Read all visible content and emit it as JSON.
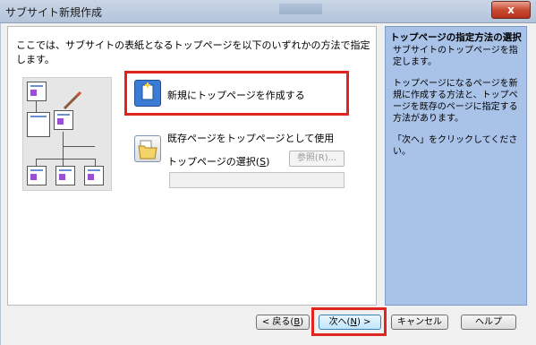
{
  "window": {
    "title": "サブサイト新規作成",
    "close_label": "x"
  },
  "main": {
    "intro": "ここでは、サブサイトの表紙となるトップページを以下のいずれかの方法で指定します。",
    "option_create": {
      "label": "新規にトップページを作成する",
      "icon": "new-document-icon"
    },
    "option_existing": {
      "label": "既存ページをトップページとして使用",
      "icon": "open-folder-icon"
    },
    "select_page": {
      "label_prefix": "トップページの選択(",
      "accel": "S",
      "label_suffix": ")",
      "value": ""
    },
    "browse_button": {
      "label": "参照(R)..."
    }
  },
  "help": {
    "title": "トップページの指定方法の選択",
    "paragraphs": [
      "サブサイトのトップページを指定します。",
      "トップページになるページを新規に作成する方法と、トップページを既存のページに指定する方法があります。",
      "「次へ」をクリックしてください。"
    ]
  },
  "footer": {
    "back": {
      "prefix": "< 戻る(",
      "accel": "B",
      "suffix": ")"
    },
    "next": {
      "prefix": "次へ(",
      "accel": "N",
      "suffix": ") >"
    },
    "cancel": "キャンセル",
    "help": "ヘルプ"
  },
  "colors": {
    "highlight": "#e0241f",
    "help_pane": "#a9c2e8",
    "selected_option": "#3a7bd5"
  }
}
